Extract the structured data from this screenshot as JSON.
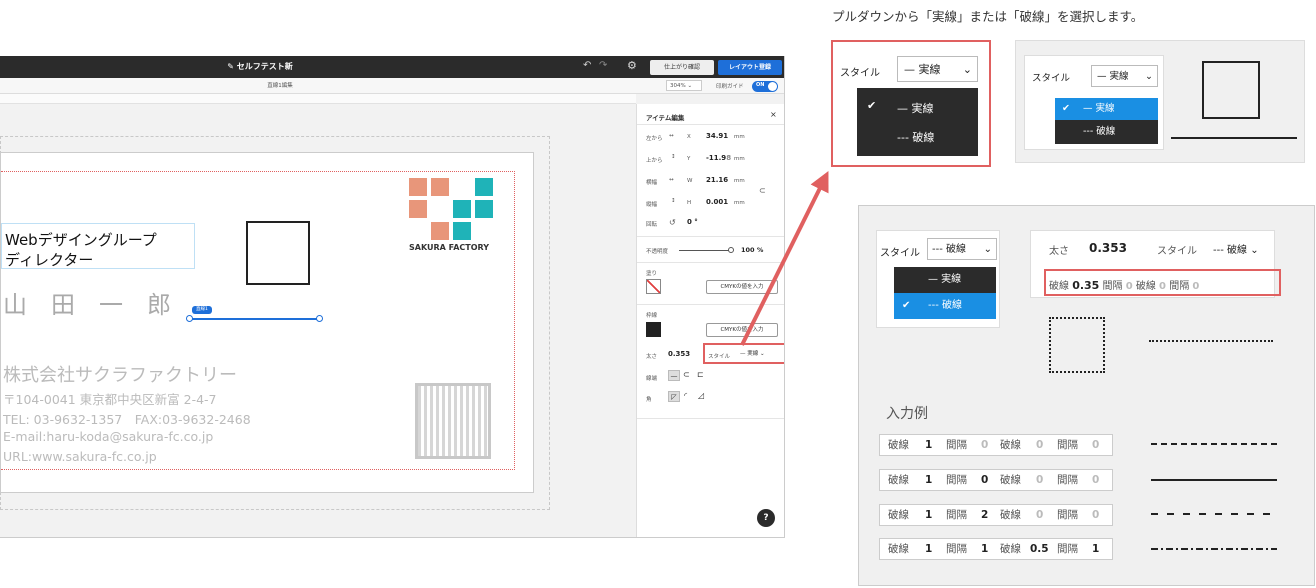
{
  "caption": "プルダウンから「実線」または「破線」を選択します。",
  "app": {
    "title": "セルフテスト新",
    "confirm_button": "仕上がり確認",
    "register_button": "レイアウト登録",
    "sub_title": "直線1編集",
    "zoom": "304%",
    "print_guide_label": "印刷ガイド",
    "print_guide_toggle": "ON"
  },
  "card": {
    "job_title_line1": "Webデザイングループ",
    "job_title_line2": "ディレクター",
    "name": "山　田　一　郎",
    "company": "株式会社サクラファクトリー",
    "address": "〒104-0041 東京都中央区新富 2-4-7",
    "tel_fax": "TEL: 03-9632-1357　FAX:03-9632-2468",
    "email": "E-mail:haru-koda@sakura-fc.co.jp",
    "url": "URL:www.sakura-fc.co.jp",
    "logo_text": "SAKURA FACTORY",
    "line_tag": "直線1"
  },
  "panel": {
    "header": "アイテム編集",
    "left_label": "左から",
    "x_label": "X",
    "x_value": "34.91",
    "top_label": "上から",
    "y_label": "Y",
    "y_value": "-11.9\b",
    "width_label": "横幅",
    "w_label": "W",
    "w_value": "21.16",
    "height_label": "縦幅",
    "h_label": "H",
    "h_value": "0.001",
    "unit": "mm",
    "rotate_label": "回転",
    "rotate_value": "0 °",
    "opacity_label": "不透明度",
    "opacity_value": "100 %",
    "opacity_level": 1.0,
    "fill_label": "塗り",
    "cmyk_button": "CMYKの値を入力",
    "stroke_label": "枠線",
    "cmyk_button2": "CMYKの値を入力",
    "thickness_label": "太さ",
    "thickness_value": "0.353",
    "style_label": "スタイル",
    "style_value": "— 実線",
    "linecap_label": "線端",
    "corner_label": "角",
    "help": "?"
  },
  "demo1": {
    "style_label": "スタイル",
    "selected": "— 実線",
    "options": [
      "— 実線",
      "--- 破線"
    ]
  },
  "demo2": {
    "style_label": "スタイル",
    "selected": "— 実線",
    "options": [
      "— 実線",
      "--- 破線"
    ]
  },
  "demo3": {
    "style_label": "スタイル",
    "selected": "--- 破線",
    "options": [
      "— 実線",
      "--- 破線"
    ],
    "thickness_label": "太さ",
    "thickness_value": "0.353",
    "style_label2": "スタイル",
    "style_value2": "--- 破線",
    "dash_row": {
      "l1": "破線",
      "v1": "0.35",
      "l2": "間隔",
      "v2": "0",
      "l3": "破線",
      "v3": "0",
      "l4": "間隔",
      "v4": "0"
    }
  },
  "examples": {
    "heading": "入力例",
    "rows": [
      {
        "l1": "破線",
        "v1": "1",
        "l2": "間隔",
        "v2": "0",
        "l3": "破線",
        "v3": "0",
        "l4": "間隔",
        "v4": "0"
      },
      {
        "l1": "破線",
        "v1": "1",
        "l2": "間隔",
        "v2": "0",
        "l3": "破線",
        "v3": "0",
        "l4": "間隔",
        "v4": "0"
      },
      {
        "l1": "破線",
        "v1": "1",
        "l2": "間隔",
        "v2": "2",
        "l3": "破線",
        "v3": "0",
        "l4": "間隔",
        "v4": "0"
      },
      {
        "l1": "破線",
        "v1": "1",
        "l2": "間隔",
        "v2": "1",
        "l3": "破線",
        "v3": "0.5",
        "l4": "間隔",
        "v4": "1"
      }
    ]
  },
  "colors": {
    "accent": "#1e6fd9",
    "highlight": "#e06060",
    "select_blue": "#1a8fe3",
    "logo_salmon": "#e8967a",
    "logo_teal": "#1fb3b8"
  }
}
